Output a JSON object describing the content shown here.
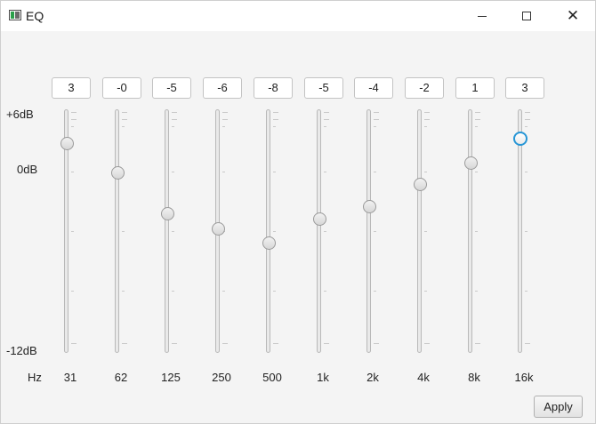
{
  "window": {
    "title": "EQ",
    "icon": "equalizer-app-icon",
    "controls": [
      "minimize-icon",
      "maximize-icon",
      "close-icon"
    ]
  },
  "scale": {
    "top_label": "+6dB",
    "mid_label": "0dB",
    "bottom_label": "-12dB",
    "max_db": 6,
    "min_db": -12,
    "hz_label": "Hz"
  },
  "bands": [
    {
      "freq": "31",
      "value_text": "3",
      "level": 0.86
    },
    {
      "freq": "62",
      "value_text": "-0",
      "level": 0.74
    },
    {
      "freq": "125",
      "value_text": "-5",
      "level": 0.57
    },
    {
      "freq": "250",
      "value_text": "-6",
      "level": 0.51
    },
    {
      "freq": "500",
      "value_text": "-8",
      "level": 0.45
    },
    {
      "freq": "1k",
      "value_text": "-5",
      "level": 0.55
    },
    {
      "freq": "2k",
      "value_text": "-4",
      "level": 0.6
    },
    {
      "freq": "4k",
      "value_text": "-2",
      "level": 0.69
    },
    {
      "freq": "8k",
      "value_text": "1",
      "level": 0.78
    },
    {
      "freq": "16k",
      "value_text": "3",
      "level": 0.88,
      "focused": true
    }
  ],
  "buttons": {
    "apply_label": "Apply"
  },
  "colors": {
    "focus": "#2796d6"
  }
}
